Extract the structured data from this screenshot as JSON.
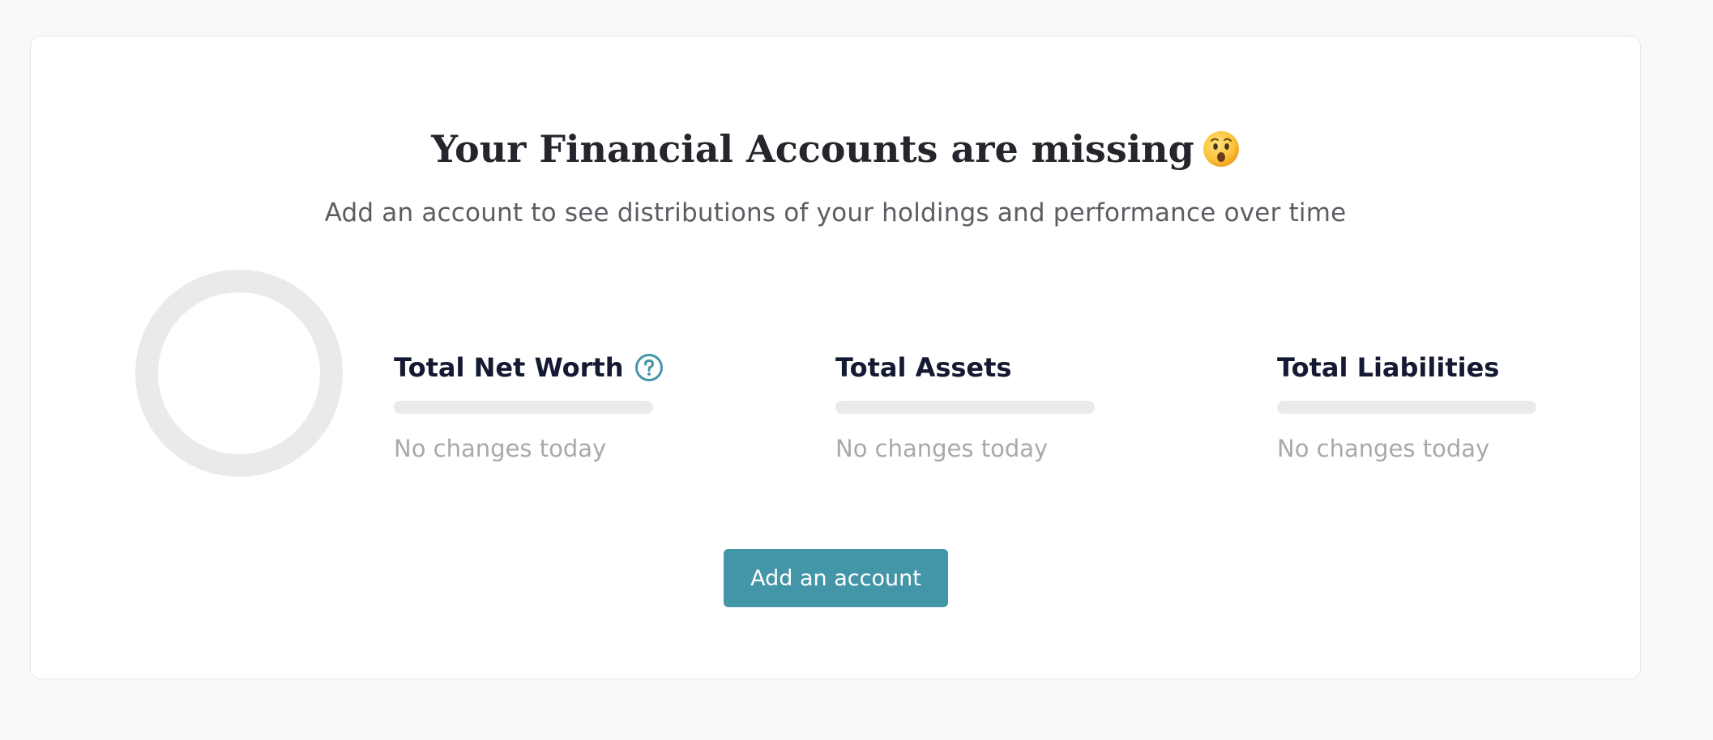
{
  "header": {
    "title": "Your Financial Accounts are missing",
    "emoji_icon": "hushed-face-emoji",
    "subtitle": "Add an account to see distributions of your holdings and performance over time"
  },
  "chart": {
    "icon": "empty-donut-ring"
  },
  "stats": [
    {
      "label": "Total Net Worth",
      "change": "No changes today",
      "help_icon": "question-circle-icon"
    },
    {
      "label": "Total Assets",
      "change": "No changes today"
    },
    {
      "label": "Total Liabilities",
      "change": "No changes today"
    }
  ],
  "actions": {
    "add_account_label": "Add an account"
  },
  "colors": {
    "accent": "#4396a7",
    "placeholder": "#ebeae8",
    "heading": "#141a31",
    "muted": "#a9a9ad"
  }
}
